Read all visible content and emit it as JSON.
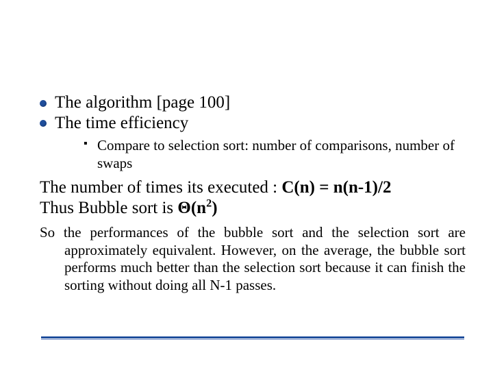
{
  "bullets": {
    "b1": "The algorithm [page 100]",
    "b2": "The time efficiency",
    "sub1": "Compare to selection sort: number of comparisons, number of swaps"
  },
  "conclusion": {
    "line1_prefix": "The number of times its executed : ",
    "formula1": "C(n) = n(n-1)/2",
    "line2_prefix": "Thus Bubble sort is ",
    "theta_open": "Θ(n",
    "theta_exp": "2",
    "theta_close": ")"
  },
  "perf": "So the performances of the bubble sort and the selection sort are approximately equivalent. However, on the average, the bubble sort performs much better than the selection sort because it can finish the sorting without doing all N-1 passes."
}
